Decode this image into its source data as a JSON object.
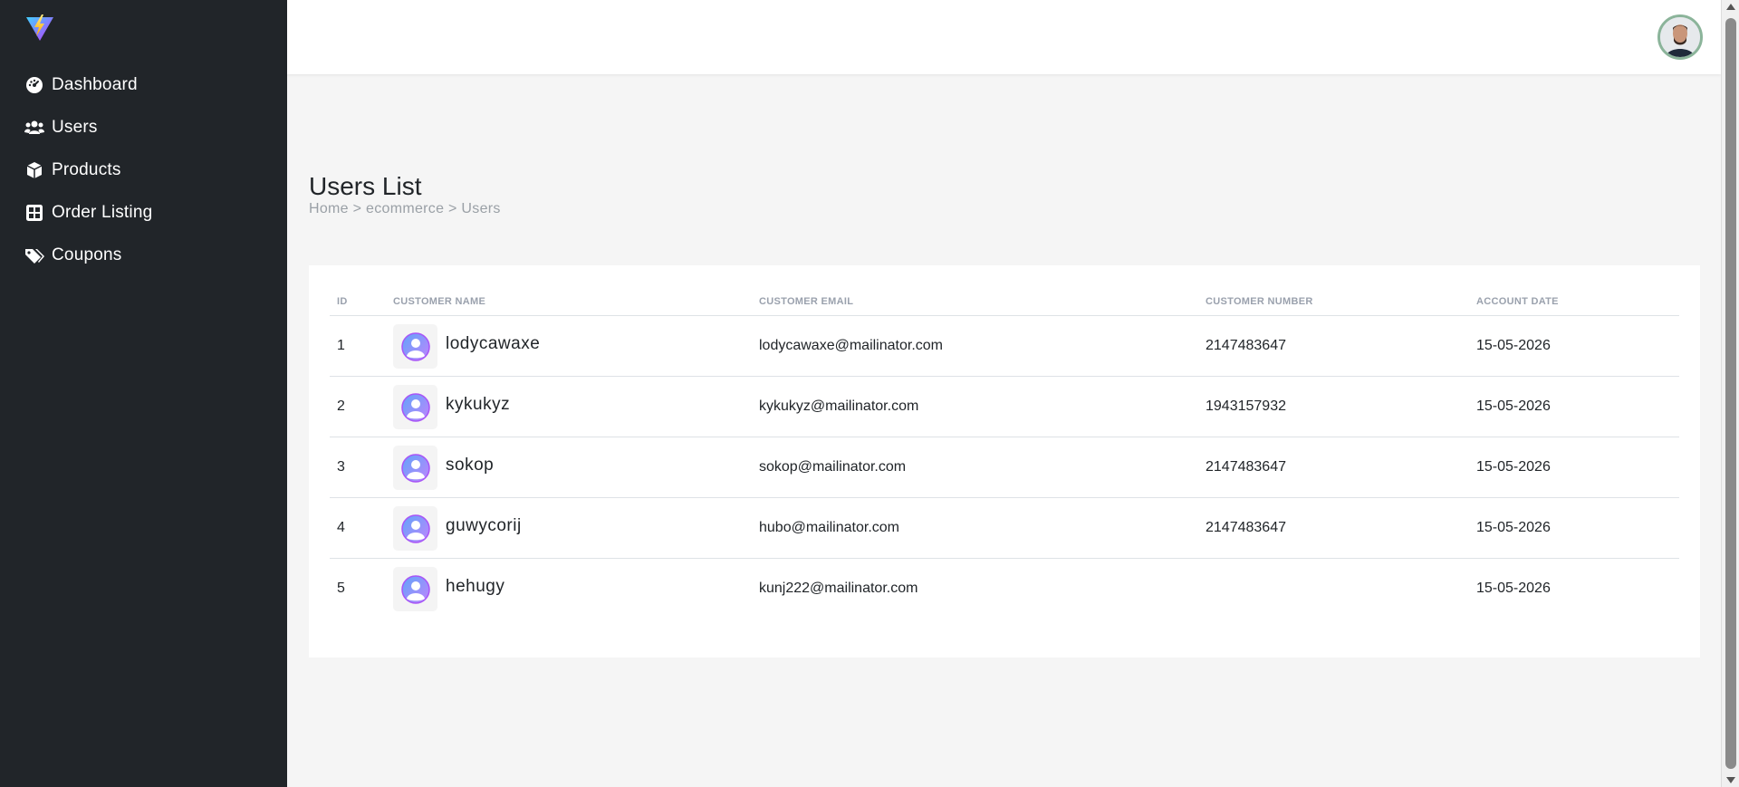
{
  "sidebar": {
    "logo_icon": "vite-logo-icon",
    "items": [
      {
        "label": "Dashboard",
        "icon": "gauge-icon"
      },
      {
        "label": "Users",
        "icon": "users-icon"
      },
      {
        "label": "Products",
        "icon": "box-icon"
      },
      {
        "label": "Order Listing",
        "icon": "grid-icon"
      },
      {
        "label": "Coupons",
        "icon": "tags-icon"
      }
    ]
  },
  "header": {
    "avatar_icon": "user-avatar"
  },
  "page": {
    "title": "Users List",
    "breadcrumb": "Home > ecommerce > Users"
  },
  "table": {
    "headers": {
      "id": "ID",
      "name": "CUSTOMER NAME",
      "email": "CUSTOMER EMAIL",
      "number": "CUSTOMER NUMBER",
      "date": "ACCOUNT DATE"
    },
    "rows": [
      {
        "id": "1",
        "name": "lodycawaxe",
        "email": "lodycawaxe@mailinator.com",
        "number": "2147483647",
        "date": "15-05-2026"
      },
      {
        "id": "2",
        "name": "kykukyz",
        "email": "kykukyz@mailinator.com",
        "number": "1943157932",
        "date": "15-05-2026"
      },
      {
        "id": "3",
        "name": "sokop",
        "email": "sokop@mailinator.com",
        "number": "2147483647",
        "date": "15-05-2026"
      },
      {
        "id": "4",
        "name": "guwycorij",
        "email": "hubo@mailinator.com",
        "number": "2147483647",
        "date": "15-05-2026"
      },
      {
        "id": "5",
        "name": "hehugy",
        "email": "kunj222@mailinator.com",
        "number": "",
        "date": "15-05-2026"
      }
    ]
  },
  "colors": {
    "sidebar_bg": "#212529",
    "page_bg": "#f5f5f5",
    "header_text": "#9aa1ad",
    "avatar_accent": "#a855f7"
  }
}
